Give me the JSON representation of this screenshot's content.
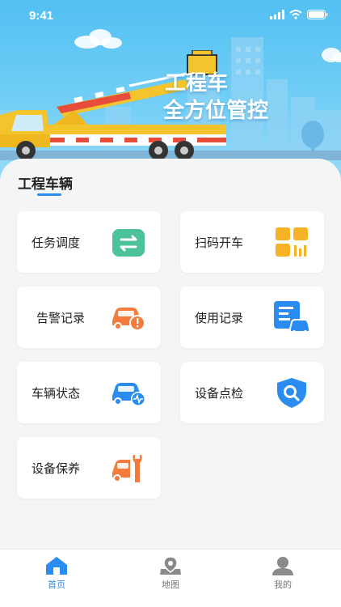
{
  "status_bar": {
    "time": "9:41"
  },
  "hero": {
    "title_line1": "工程车",
    "title_line2": "全方位管控"
  },
  "section": {
    "title": "工程车辆"
  },
  "tiles": [
    {
      "label": "任务调度",
      "icon": "task-schedule-icon",
      "color": "#4cc29a"
    },
    {
      "label": "扫码开车",
      "icon": "scan-qr-icon",
      "color": "#f5b325"
    },
    {
      "label": "告警记录",
      "icon": "car-alert-icon",
      "color": "#f37b3b"
    },
    {
      "label": "使用记录",
      "icon": "usage-record-icon",
      "color": "#2a8cf0"
    },
    {
      "label": "车辆状态",
      "icon": "car-status-icon",
      "color": "#2a8cf0"
    },
    {
      "label": "设备点检",
      "icon": "shield-search-icon",
      "color": "#2a8cf0"
    },
    {
      "label": "设备保养",
      "icon": "car-wrench-icon",
      "color": "#f37b3b"
    }
  ],
  "tabbar": {
    "items": [
      {
        "label": "首页",
        "icon": "home-icon",
        "active": true
      },
      {
        "label": "地图",
        "icon": "map-pin-icon",
        "active": false
      },
      {
        "label": "我的",
        "icon": "user-icon",
        "active": false
      }
    ],
    "active_color": "#2a8cf0"
  }
}
